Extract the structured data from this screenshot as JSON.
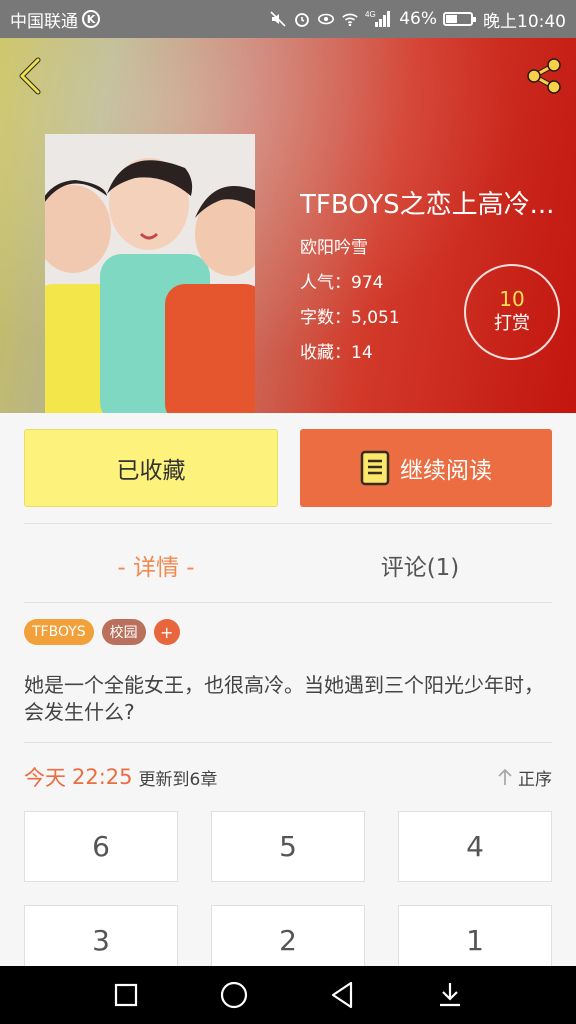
{
  "status_bar": {
    "carrier": "中国联通",
    "carrier_badge": "K",
    "network": "4G",
    "battery_percent": "46%",
    "battery_level": 0.46,
    "time": "晚上10:40",
    "icons": [
      "mute-icon",
      "alarm-icon",
      "eye-icon",
      "wifi-icon",
      "signal-icon",
      "battery-icon"
    ]
  },
  "header": {
    "back_icon": "chevron-left-icon",
    "share_icon": "share-icon"
  },
  "book": {
    "title": "TFBOYS之恋上高冷...",
    "author": "欧阳吟雪",
    "popularity": "人气：974",
    "word_count": "字数：5,051",
    "favorites": "收藏：14"
  },
  "reward": {
    "count": "10",
    "label": "打赏"
  },
  "actions": {
    "favorite_label": "已收藏",
    "read_label": "继续阅读",
    "read_icon": "book-icon"
  },
  "tabs": {
    "details": "- 详情 -",
    "comments": "评论(1)"
  },
  "tags": [
    "TFBOYS",
    "校园"
  ],
  "tag_add": "+",
  "description": "她是一个全能女王，也很高冷。当她遇到三个阳光少年时，会发生什么?",
  "update": {
    "day": "今天",
    "time": "22:25",
    "info": "更新到6章",
    "sort_label": "正序"
  },
  "chapters": [
    "6",
    "5",
    "4",
    "3",
    "2",
    "1"
  ],
  "colors": {
    "accent": "#eb6d41",
    "fav_button": "#fcf27c",
    "tag_tfboys": "#f2a03a",
    "tag_school": "#b9705c",
    "reward_number": "#ffdd55"
  }
}
